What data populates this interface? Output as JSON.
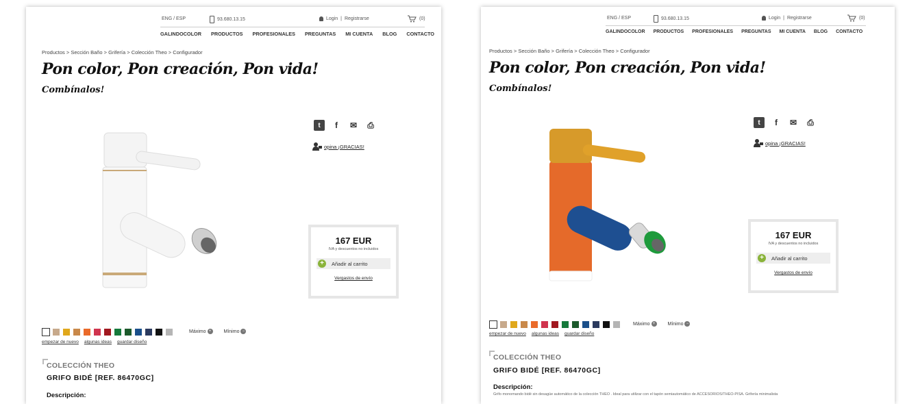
{
  "header": {
    "lang": "ENG / ESP",
    "phone": "93.680.13.15",
    "login": "Login",
    "register": "Registrarse",
    "cart_count": "(0)"
  },
  "nav": [
    "GALINDOCOLOR",
    "PRODUCTOS",
    "PROFESIONALES",
    "PREGUNTAS",
    "MI CUENTA",
    "BLOG",
    "CONTACTO"
  ],
  "breadcrumb": "Productos > Sección Baño > Grifería > Colección Theo > Configurador",
  "title": "Pon color, Pon creación, Pon vida!",
  "subtitle": "Combínalos!",
  "opina": "opina ¡GRACIAS!",
  "price": "167 EUR",
  "iva": "IVA y descuentos no incluidos",
  "add_to_cart": "Añadir al carrito",
  "shipping": "Vergastos de envío",
  "palette": [
    "#ffffff",
    "#c7a98b",
    "#e0a81c",
    "#c9894a",
    "#ea6a2a",
    "#d0344e",
    "#a1181f",
    "#157a3b",
    "#1c5a2c",
    "#1a4f8a",
    "#2b3a5e",
    "#111111",
    "#b5b5b5"
  ],
  "maximo": "Máximo",
  "minimo": "Mínimo",
  "links": [
    "empezar de nuevo",
    "algunas ideas",
    "guardar diseño"
  ],
  "coleccion": "COLECCIÓN THEO",
  "product_name": "GRIFO BIDÉ [REF. 86470GC]",
  "description_label": "Descripción:",
  "description_text": "Grifo monomando bidé sin desagüe automático de la colección THEO . Ideal para utilizar con el tapón semiautomático de ACCESORIOS/THEO-PISA. Grifería minimalista",
  "faucet_colors": {
    "left": {
      "cap": "#f4f4f4",
      "body": "#f7f7f7",
      "spout": "#f5f5f5",
      "tip": "#cfcfcf",
      "handle": "#f2f2f2",
      "trim": "#c9a978"
    },
    "right": {
      "cap": "#d79a2a",
      "body": "#e56a2a",
      "spout": "#1e4f91",
      "tip": "#1e9a3c",
      "handle": "#e0a12a",
      "trim": "#ffffff"
    }
  }
}
